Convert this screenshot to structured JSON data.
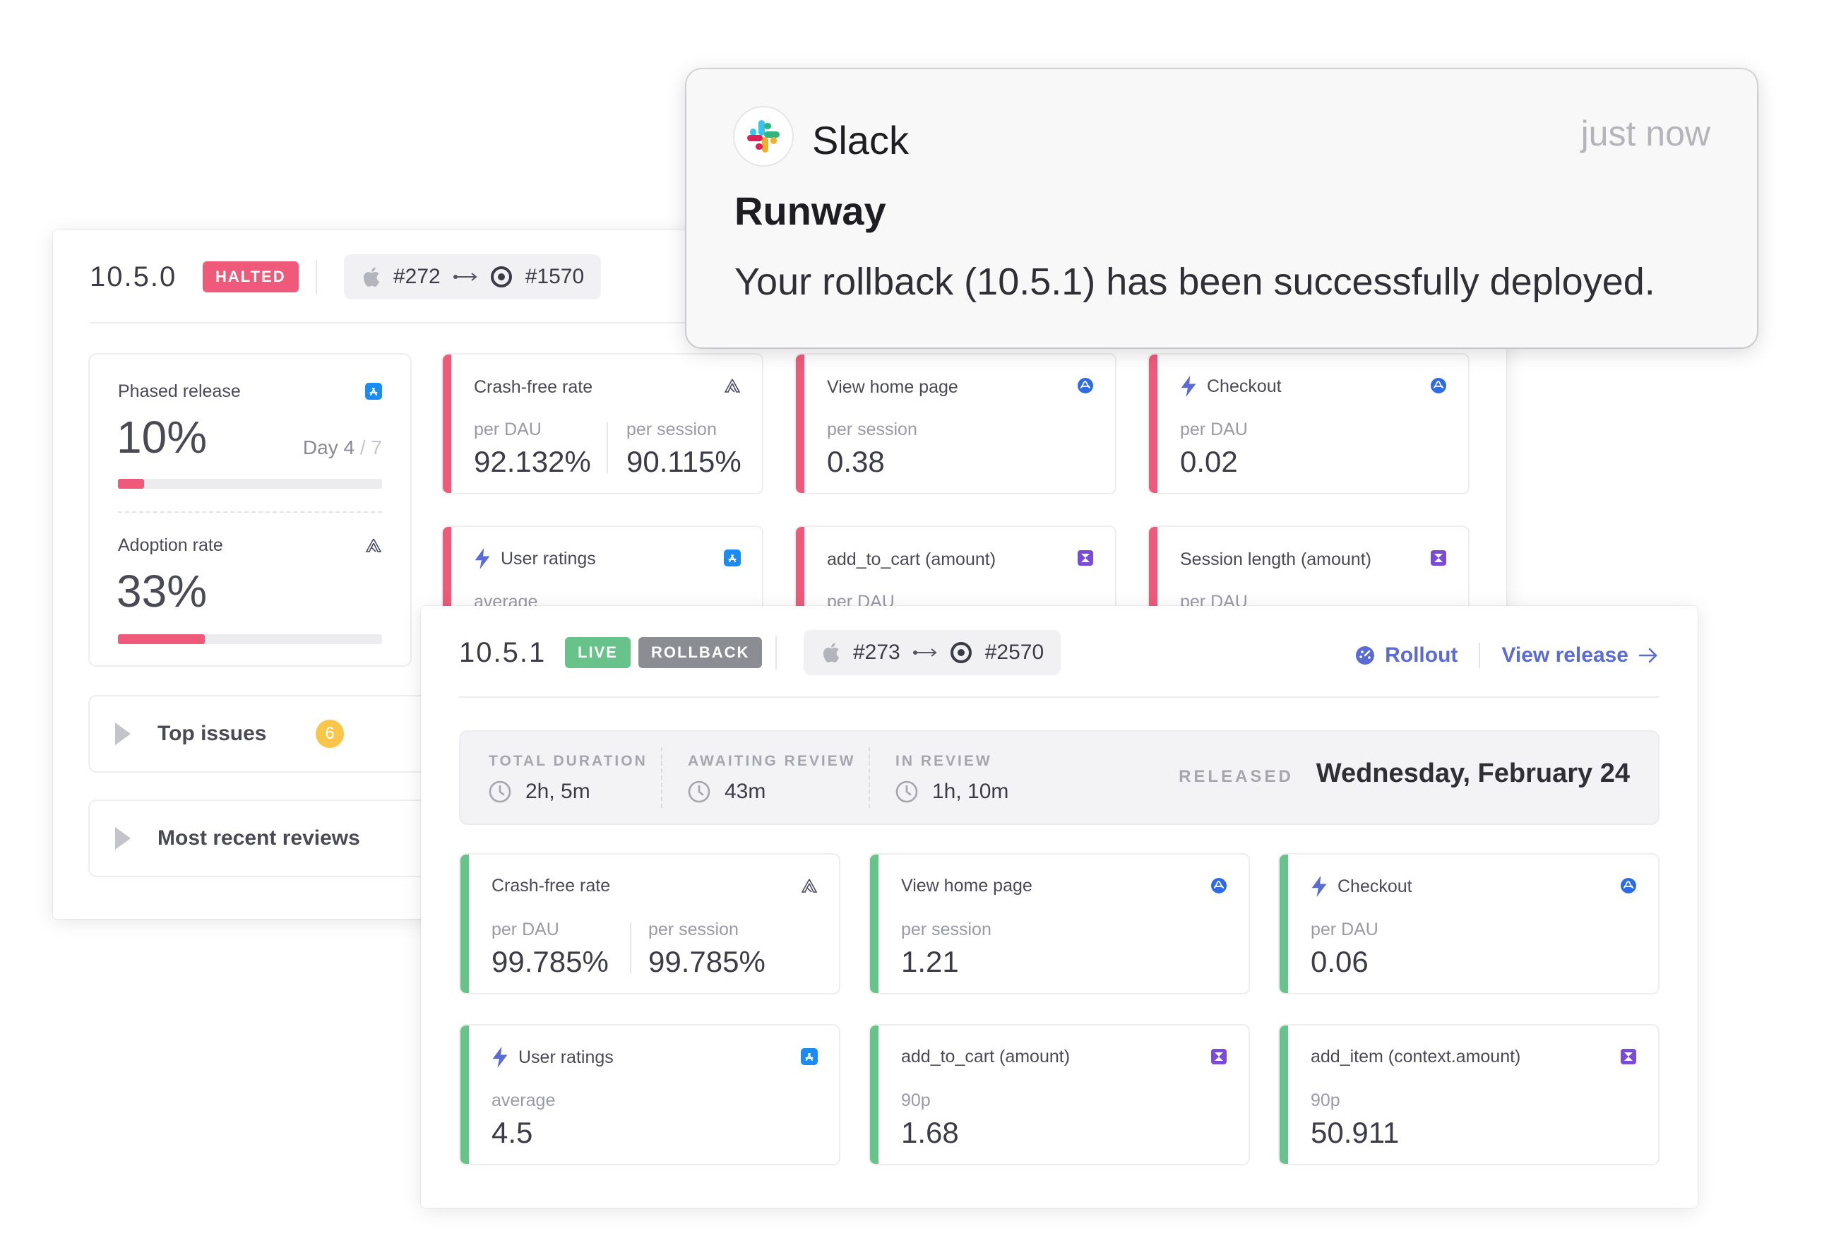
{
  "colors": {
    "halted": "#ef5a7a",
    "live": "#67c389",
    "rollback": "#8c8c94",
    "accent": "#5b6bd4",
    "issues_badge": "#f9c64a",
    "bad_metric_bar": "#ef5a7a",
    "good_metric_bar": "#67c389"
  },
  "slack_notification": {
    "app": "Slack",
    "time": "just now",
    "title": "Runway",
    "message": "Your rollback (10.5.1) has been successfully deployed.",
    "icon": "slack-icon"
  },
  "previous_release": {
    "version": "10.5.0",
    "status": "HALTED",
    "build_ios": "#272",
    "build_ci": "#1570",
    "phased_release": {
      "label": "Phased release",
      "percent": "10%",
      "day_current": "Day 4",
      "day_sep": " / 7",
      "progress": 0.1
    },
    "adoption": {
      "label": "Adoption rate",
      "percent": "33%",
      "progress": 0.33
    },
    "accordions": {
      "top_issues": "Top issues",
      "top_issues_count": "6",
      "recent_reviews": "Most recent reviews"
    },
    "metrics": [
      {
        "title": "Crash-free rate",
        "sub1": "per DAU",
        "val1": "92.132%",
        "sub2": "per session",
        "val2": "90.115%",
        "icon": "sentry-icon"
      },
      {
        "title": "View home page",
        "sub1": "per session",
        "val1": "0.38",
        "icon": "amplitude-icon"
      },
      {
        "title": "Checkout",
        "sub1": "per DAU",
        "val1": "0.02",
        "icon": "amplitude-icon",
        "bolt": true
      },
      {
        "title": "User ratings",
        "sub1": "average",
        "icon": "app-store-icon",
        "bolt": true
      },
      {
        "title": "add_to_cart (amount)",
        "sub1": "per DAU",
        "icon": "mixpanel-icon"
      },
      {
        "title": "Session length (amount)",
        "sub1": "per DAU",
        "icon": "mixpanel-icon"
      }
    ]
  },
  "current_release": {
    "version": "10.5.1",
    "status_live": "LIVE",
    "status_rollback": "ROLLBACK",
    "build_ios": "#273",
    "build_ci": "#2570",
    "rollout_link": "Rollout",
    "view_release_link": "View release",
    "timeline": {
      "total_duration_label": "TOTAL DURATION",
      "total_duration": "2h, 5m",
      "awaiting_review_label": "AWAITING REVIEW",
      "awaiting_review": "43m",
      "in_review_label": "IN REVIEW",
      "in_review": "1h, 10m",
      "released_label": "RELEASED",
      "released_date": "Wednesday, February 24"
    },
    "metrics": [
      {
        "title": "Crash-free rate",
        "sub1": "per DAU",
        "val1": "99.785%",
        "sub2": "per session",
        "val2": "99.785%",
        "icon": "sentry-icon"
      },
      {
        "title": "View home page",
        "sub1": "per session",
        "val1": "1.21",
        "icon": "amplitude-icon"
      },
      {
        "title": "Checkout",
        "sub1": "per DAU",
        "val1": "0.06",
        "icon": "amplitude-icon",
        "bolt": true
      },
      {
        "title": "User ratings",
        "sub1": "average",
        "val1": "4.5",
        "icon": "app-store-icon",
        "bolt": true
      },
      {
        "title": "add_to_cart (amount)",
        "sub1": "90p",
        "val1": "1.68",
        "icon": "mixpanel-icon"
      },
      {
        "title": "add_item (context.amount)",
        "sub1": "90p",
        "val1": "50.911",
        "icon": "mixpanel-icon"
      }
    ]
  }
}
